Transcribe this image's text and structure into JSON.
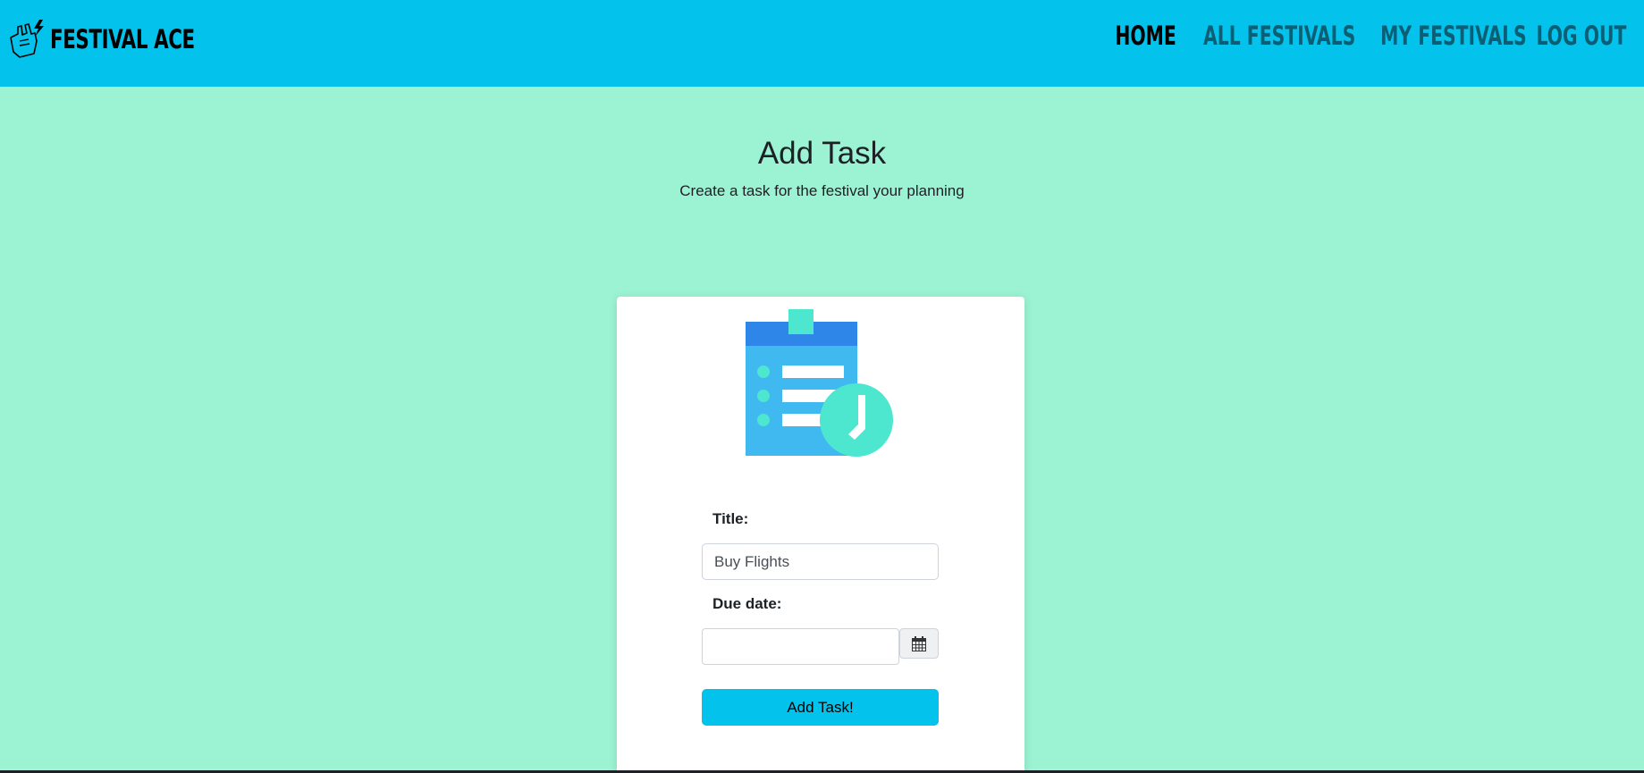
{
  "app": {
    "brand_name": "FESTIVAL ACE",
    "brand_logo_icon": "rock-hand-lightning-icon",
    "colors": {
      "navbar": "#03c3ec",
      "background": "#9bf3d3",
      "card": "#ffffff",
      "accent_button": "#03c3ec",
      "nav_link": "#0c5e75",
      "nav_link_active": "#000000"
    }
  },
  "nav": {
    "items": [
      {
        "label": "HOME",
        "active": true
      },
      {
        "label": "ALL FESTIVALS",
        "active": false
      },
      {
        "label": "MY FESTIVALS",
        "active": false
      },
      {
        "label": "LOG OUT",
        "active": false
      }
    ]
  },
  "page": {
    "title": "Add Task",
    "subtitle": "Create a task for the festival your planning"
  },
  "card": {
    "illustration_icon": "clipboard-clock-icon"
  },
  "form": {
    "title_label": "Title:",
    "title_value": "Buy Flights",
    "due_date_label": "Due date:",
    "due_date_value": "",
    "calendar_icon": "calendar-icon",
    "submit_label": "Add Task!"
  }
}
